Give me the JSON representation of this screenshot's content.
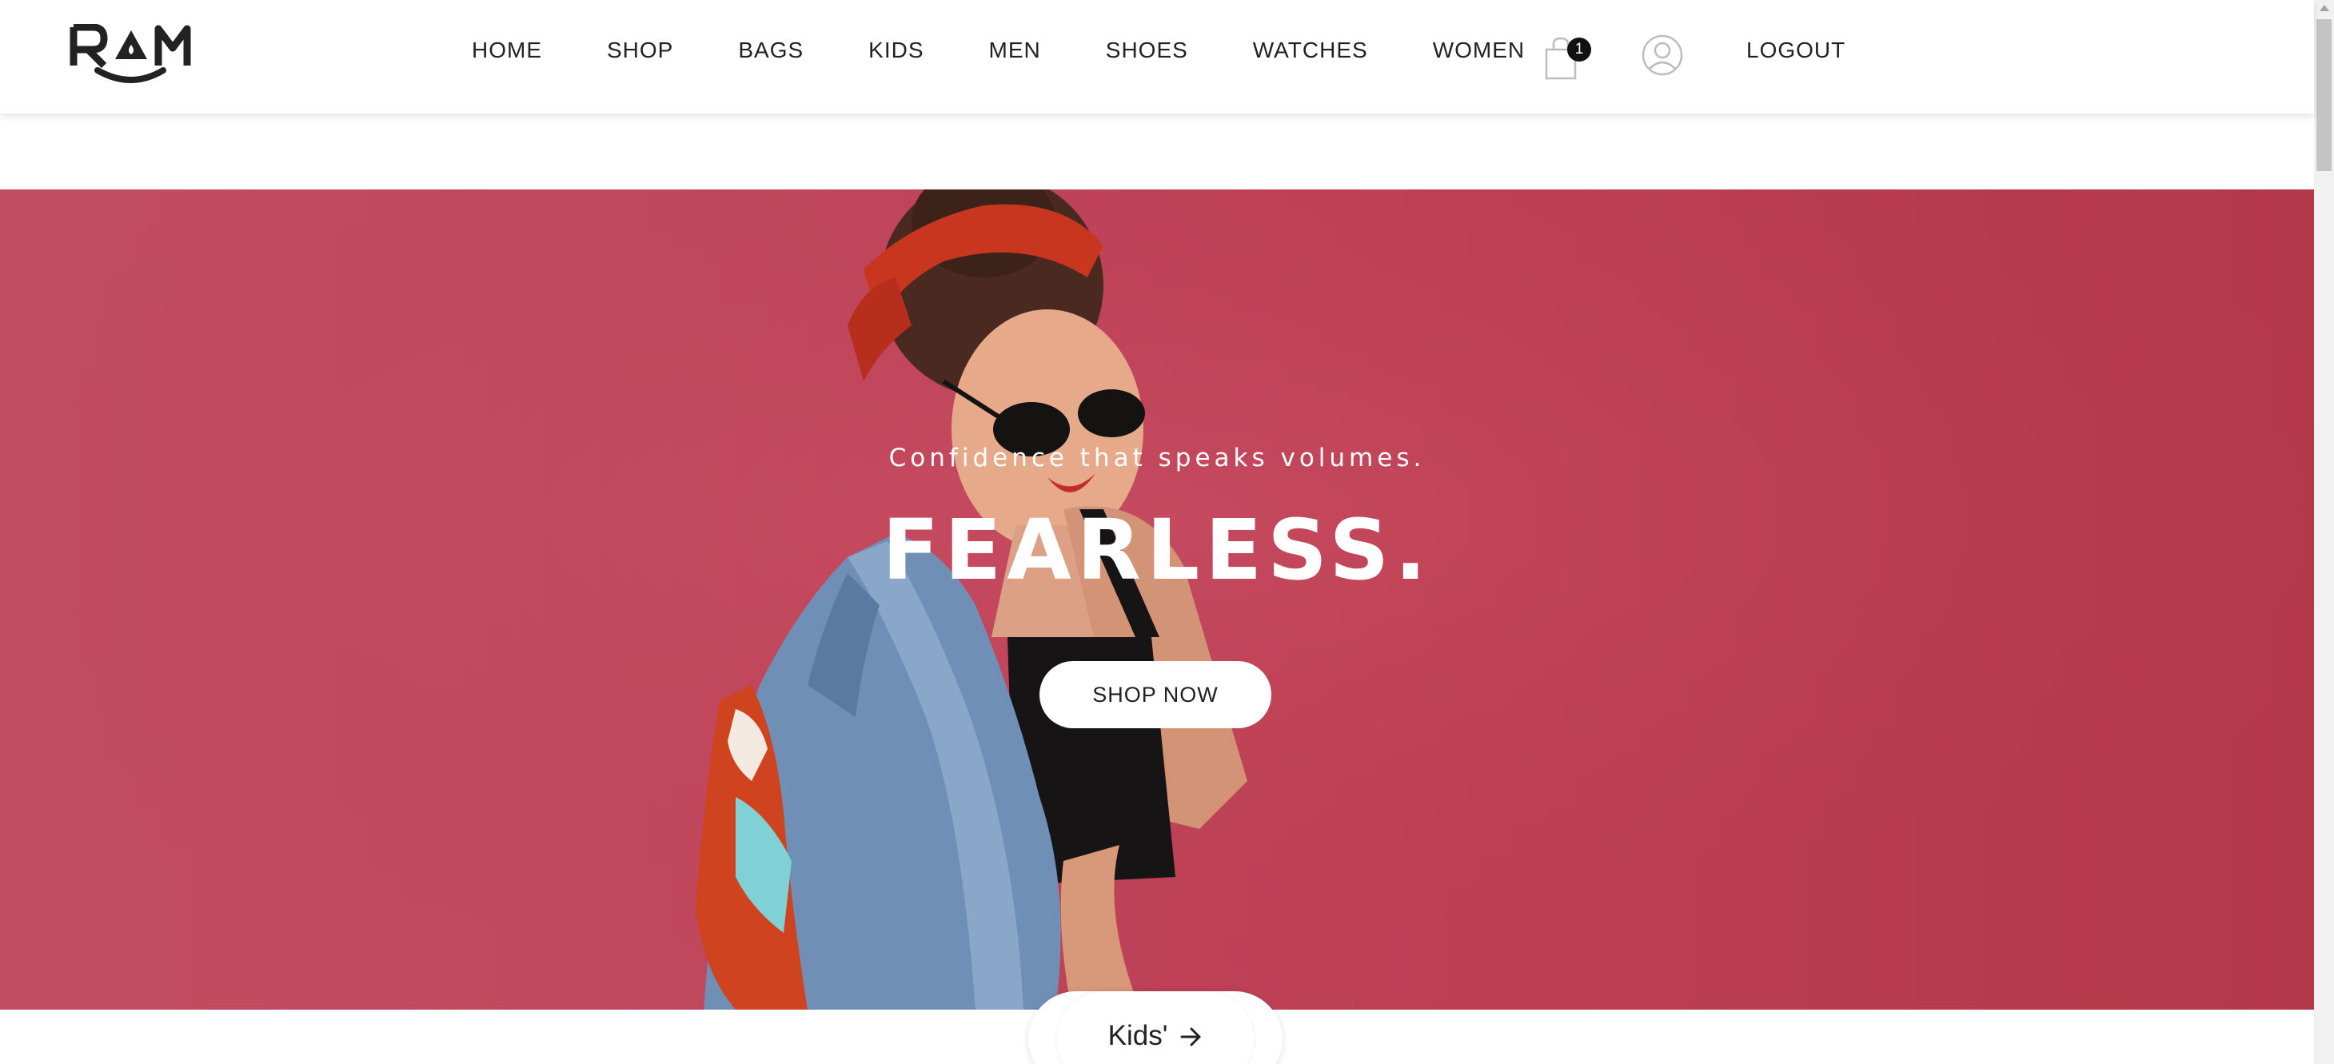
{
  "header": {
    "logo_text": "RAM",
    "nav": [
      "HOME",
      "SHOP",
      "BAGS",
      "KIDS",
      "MEN",
      "SHOES",
      "WATCHES",
      "WOMEN"
    ],
    "cart_count": "1",
    "cart_icon": "shopping-bag-icon",
    "user_icon": "user-circle-icon",
    "logout_label": "LOGOUT"
  },
  "hero": {
    "tagline": "Confidence that speaks volumes.",
    "title": "FEARLESS.",
    "cta_label": "SHOP NOW",
    "background_color": "#c1475c",
    "image": "woman in sunglasses, denim jacket and red headscarf smiling"
  },
  "category_card": {
    "label": "Kids'",
    "icon": "arrow-right-icon"
  }
}
